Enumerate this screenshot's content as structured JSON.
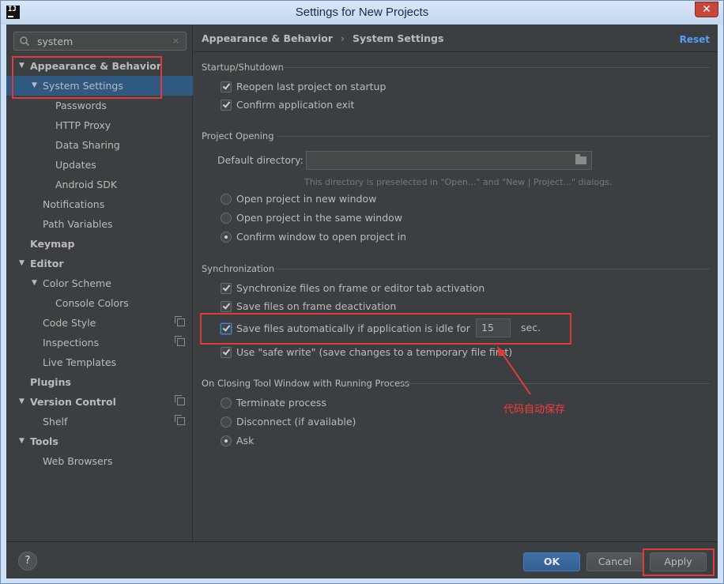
{
  "window": {
    "title": "Settings for New Projects",
    "close_glyph": "✕",
    "app_icon_text": "IJ"
  },
  "search": {
    "value": "system",
    "clear_glyph": "×"
  },
  "sidebar": {
    "items": [
      {
        "label": "Appearance & Behavior",
        "arrow": "▼"
      },
      {
        "label": "System Settings",
        "arrow": "▼"
      },
      {
        "label": "Passwords"
      },
      {
        "label": "HTTP Proxy"
      },
      {
        "label": "Data Sharing"
      },
      {
        "label": "Updates"
      },
      {
        "label": "Android SDK"
      },
      {
        "label": "Notifications"
      },
      {
        "label": "Path Variables"
      },
      {
        "label": "Keymap"
      },
      {
        "label": "Editor",
        "arrow": "▼"
      },
      {
        "label": "Color Scheme",
        "arrow": "▼"
      },
      {
        "label": "Console Colors"
      },
      {
        "label": "Code Style"
      },
      {
        "label": "Inspections"
      },
      {
        "label": "Live Templates"
      },
      {
        "label": "Plugins"
      },
      {
        "label": "Version Control",
        "arrow": "▼"
      },
      {
        "label": "Shelf"
      },
      {
        "label": "Tools",
        "arrow": "▼"
      },
      {
        "label": "Web Browsers"
      }
    ]
  },
  "header": {
    "breadcrumb_parent": "Appearance & Behavior",
    "breadcrumb_sep": "›",
    "breadcrumb_current": "System Settings",
    "reset_label": "Reset"
  },
  "startup": {
    "title": "Startup/Shutdown",
    "reopen_label": "Reopen last project on startup",
    "reopen_checked": true,
    "confirm_exit_label": "Confirm application exit",
    "confirm_exit_checked": true
  },
  "project_opening": {
    "title": "Project Opening",
    "default_dir_label": "Default directory:",
    "default_dir_value": "",
    "hint": "This directory is preselected in \"Open...\" and \"New | Project...\" dialogs.",
    "options": [
      {
        "label": "Open project in new window",
        "selected": false
      },
      {
        "label": "Open project in the same window",
        "selected": false
      },
      {
        "label": "Confirm window to open project in",
        "selected": true
      }
    ]
  },
  "sync": {
    "title": "Synchronization",
    "frame_label": "Synchronize files on frame or editor tab activation",
    "frame_checked": true,
    "deactivation_label": "Save files on frame deactivation",
    "deactivation_checked": true,
    "idle_label": "Save files automatically if application is idle for",
    "idle_checked": true,
    "idle_seconds": "15",
    "idle_unit": "sec.",
    "safe_write_label": "Use \"safe write\" (save changes to a temporary file first)",
    "safe_write_checked": true
  },
  "closing": {
    "title": "On Closing Tool Window with Running Process",
    "options": [
      {
        "label": "Terminate process",
        "selected": false
      },
      {
        "label": "Disconnect (if available)",
        "selected": false
      },
      {
        "label": "Ask",
        "selected": true
      }
    ]
  },
  "annotation": {
    "text": "代码自动保存",
    "color": "#e03a3a"
  },
  "footer": {
    "help_label": "?",
    "ok_label": "OK",
    "cancel_label": "Cancel",
    "apply_label": "Apply"
  },
  "colors": {
    "background": "#3c3f41",
    "selection": "#2f5980",
    "accent": "#589df6",
    "primary_button": "#365f91"
  }
}
